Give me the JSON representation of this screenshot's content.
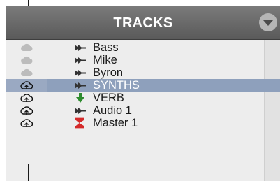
{
  "panel": {
    "title": "TRACKS",
    "selected_row_color": "#8ea0bc",
    "header_text_color": "#ffffff"
  },
  "tracks": [
    {
      "name": "Bass",
      "type_icon": "audio-track-icon",
      "cloud_icon": "cloud-icon",
      "cloud_state": "inactive",
      "selected": false
    },
    {
      "name": "Mike",
      "type_icon": "audio-track-icon",
      "cloud_icon": "cloud-icon",
      "cloud_state": "inactive",
      "selected": false
    },
    {
      "name": "Byron",
      "type_icon": "audio-track-icon",
      "cloud_icon": "cloud-icon",
      "cloud_state": "inactive",
      "selected": false
    },
    {
      "name": "SYNTHS",
      "type_icon": "audio-track-icon",
      "cloud_icon": "cloud-upload-icon",
      "cloud_state": "active",
      "selected": true
    },
    {
      "name": "VERB",
      "type_icon": "aux-input-icon",
      "cloud_icon": "cloud-upload-icon",
      "cloud_state": "active",
      "selected": false
    },
    {
      "name": "Audio 1",
      "type_icon": "audio-track-icon",
      "cloud_icon": "cloud-upload-icon",
      "cloud_state": "active",
      "selected": false
    },
    {
      "name": "Master 1",
      "type_icon": "master-fader-icon",
      "cloud_icon": "cloud-upload-icon",
      "cloud_state": "active",
      "selected": false
    }
  ]
}
